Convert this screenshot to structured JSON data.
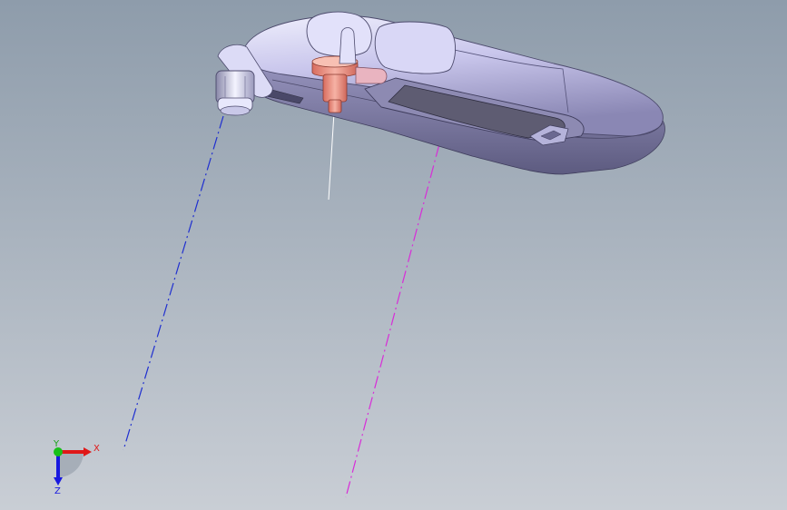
{
  "viewport": {
    "background_top": "#8e9cab",
    "background_bottom": "#c9ced5"
  },
  "model": {
    "body_color": "#cfcdf0",
    "body_shadow": "#6e6c90",
    "highlight_part_color": "#f0a092",
    "mirror_color": "#5e5c72"
  },
  "axis_lines": {
    "blue_color": "#1f2fd0",
    "magenta_color": "#d82cd8",
    "white_color": "#ffffff"
  },
  "triad": {
    "x_label": "X",
    "y_label": "Y",
    "z_label": "Z",
    "x_color": "#e01818",
    "y_color": "#18c018",
    "z_color": "#1818e0"
  }
}
